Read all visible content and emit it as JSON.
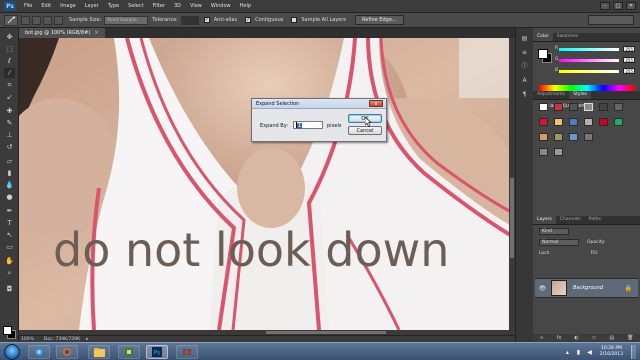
{
  "app": {
    "logo": "Ps",
    "menu": [
      "File",
      "Edit",
      "Image",
      "Layer",
      "Type",
      "Select",
      "Filter",
      "3D",
      "View",
      "Window",
      "Help"
    ],
    "window_controls": [
      "–",
      "□",
      "✕"
    ]
  },
  "options_bar": {
    "sample_size_label": "Sample Size:",
    "sample_size_value": "Point Sample",
    "tolerance_label": "Tolerance:",
    "antialias_label": "Anti-alias",
    "contiguous_label": "Contiguous",
    "sample_all_layers_label": "Sample All Layers",
    "refine_edge_label": "Refine Edge..."
  },
  "document": {
    "tab_label": "bot.jpg @ 100% (RGB/8#)",
    "tab_close": "×",
    "text_selection": "do not look down"
  },
  "status_bar": {
    "zoom": "100%",
    "doc_info": "Doc: 739K/739K",
    "arrow": "▸"
  },
  "dialog": {
    "title": "Expand Selection",
    "close": "x",
    "expand_label": "Expand By:",
    "expand_value": "1",
    "unit": "pixels",
    "ok_label": "OK",
    "cancel_label": "Cancel"
  },
  "panels": {
    "color_tabs": [
      "Color",
      "Swatches"
    ],
    "sliders": [
      {
        "label": "R",
        "value": "255"
      },
      {
        "label": "G",
        "value": "255"
      },
      {
        "label": "B",
        "value": "255"
      }
    ],
    "adjustments_tabs": [
      "Adjustments",
      "Styles"
    ],
    "adjustments_title": "Add an adjustment",
    "layers_tabs": [
      "Layers",
      "Channels",
      "Paths"
    ],
    "kind_label": "Kind",
    "blend_mode": "Normal",
    "opacity_label": "Opacity:",
    "lock_label": "Lock:",
    "fill_label": "Fill:",
    "layer_name": "Background",
    "footer_icons": [
      "∞",
      "fx",
      "◐",
      "▭",
      "▤",
      "🗑"
    ]
  },
  "taskbar": {
    "time": "10:28 PM",
    "date": "2/16/2013"
  },
  "colors": {
    "accent": "#3c7fb1",
    "ps_blue": "#1f4f7a",
    "layer_selected": "#5f6a78",
    "shirt_stripe": "#d9556e"
  }
}
